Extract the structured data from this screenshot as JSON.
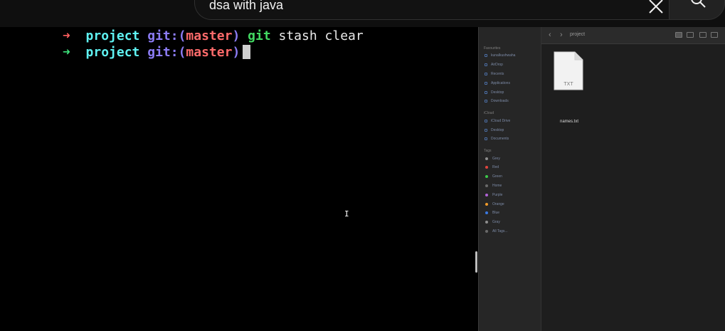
{
  "search": {
    "query": "dsa with java",
    "clear_icon": "close-icon",
    "search_icon": "search-icon"
  },
  "terminal": {
    "lines": [
      {
        "arrow": "➜",
        "dir": "project",
        "git_prefix": "git:(",
        "branch": "master",
        "git_suffix": ")",
        "git_cmd": "git",
        "args": "stash clear"
      },
      {
        "arrow": "➜",
        "dir": "project",
        "git_prefix": "git:(",
        "branch": "master",
        "git_suffix": ")"
      }
    ],
    "pointer_glyph": "I"
  },
  "finder": {
    "toolbar": {
      "back": "‹",
      "forward": "›",
      "title": "project"
    },
    "favourites_header": "Favourites",
    "favourites": [
      "kunalkushwaha",
      "AirDrop",
      "Recents",
      "Applications",
      "Desktop",
      "Downloads"
    ],
    "icloud_header": "iCloud",
    "icloud": [
      "iCloud Drive",
      "Desktop",
      "Documents"
    ],
    "tags_header": "Tags",
    "tags": [
      {
        "label": "Grey",
        "color": "#8e8e8e"
      },
      {
        "label": "Red",
        "color": "#e0443e"
      },
      {
        "label": "Green",
        "color": "#3cc84a"
      },
      {
        "label": "Home",
        "color": "#6a6a6a"
      },
      {
        "label": "Purple",
        "color": "#b062d6"
      },
      {
        "label": "Orange",
        "color": "#f09a2a"
      },
      {
        "label": "Blue",
        "color": "#3a78e0"
      },
      {
        "label": "Gray",
        "color": "#8e8e8e"
      },
      {
        "label": "All Tags...",
        "color": "#6a6a6a"
      }
    ],
    "file": {
      "name": "names.txt",
      "ext": "TXT"
    }
  }
}
